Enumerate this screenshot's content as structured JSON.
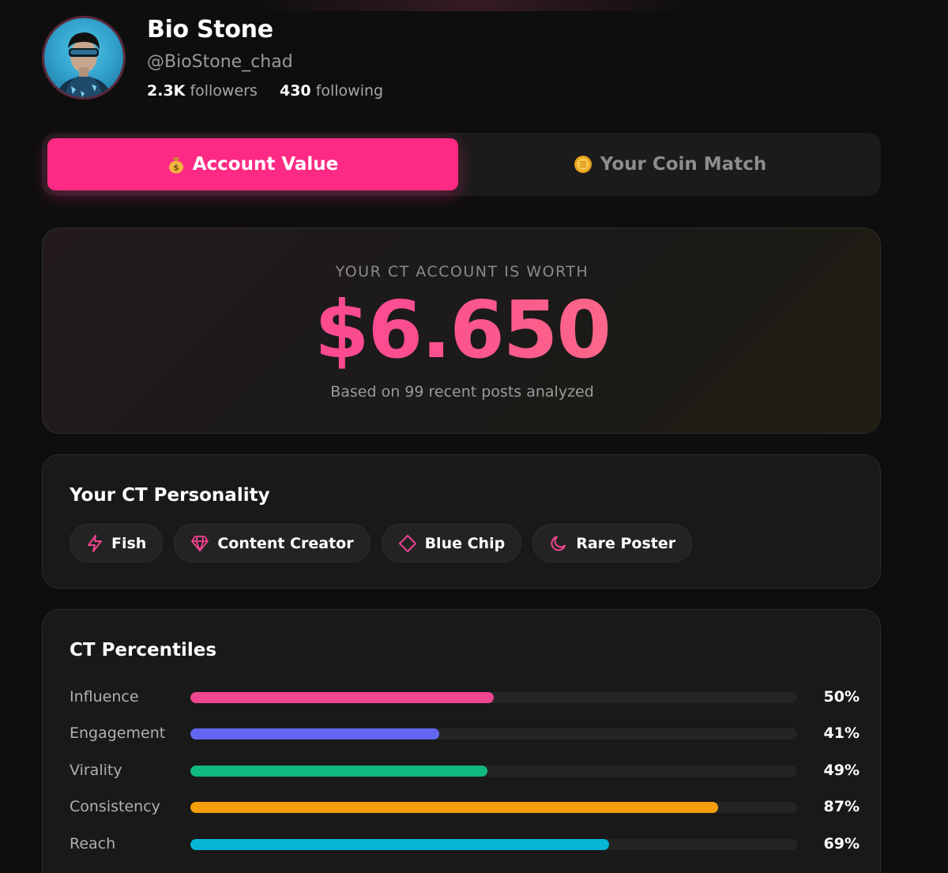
{
  "profile": {
    "name": "Bio Stone",
    "handle": "@BioStone_chad",
    "followers_count": "2.3K",
    "followers_label": "followers",
    "following_count": "430",
    "following_label": "following"
  },
  "tabs": [
    {
      "label": "Account Value",
      "icon": "money-bag-icon",
      "active": true
    },
    {
      "label": "Your Coin Match",
      "icon": "coin-icon",
      "active": false
    }
  ],
  "worth": {
    "label": "YOUR CT ACCOUNT IS WORTH",
    "value": "$6.650",
    "subtitle": "Based on 99 recent posts analyzed"
  },
  "personality": {
    "title": "Your CT Personality",
    "traits": [
      {
        "label": "Fish",
        "icon": "lightning-icon"
      },
      {
        "label": "Content Creator",
        "icon": "diamond-gem-icon"
      },
      {
        "label": "Blue Chip",
        "icon": "diamond-outline-icon"
      },
      {
        "label": "Rare Poster",
        "icon": "moon-icon"
      }
    ]
  },
  "percentiles": {
    "title": "CT Percentiles",
    "items": [
      {
        "label": "Influence",
        "value": 50,
        "display": "50%",
        "color": "#f0458f"
      },
      {
        "label": "Engagement",
        "value": 41,
        "display": "41%",
        "color": "#6366f1"
      },
      {
        "label": "Virality",
        "value": 49,
        "display": "49%",
        "color": "#10b981"
      },
      {
        "label": "Consistency",
        "value": 87,
        "display": "87%",
        "color": "#f59e0b"
      },
      {
        "label": "Reach",
        "value": 69,
        "display": "69%",
        "color": "#06b6d4"
      }
    ]
  },
  "colors": {
    "accent": "#fd2a85",
    "background": "#0e0e0e",
    "card": "#191919"
  }
}
